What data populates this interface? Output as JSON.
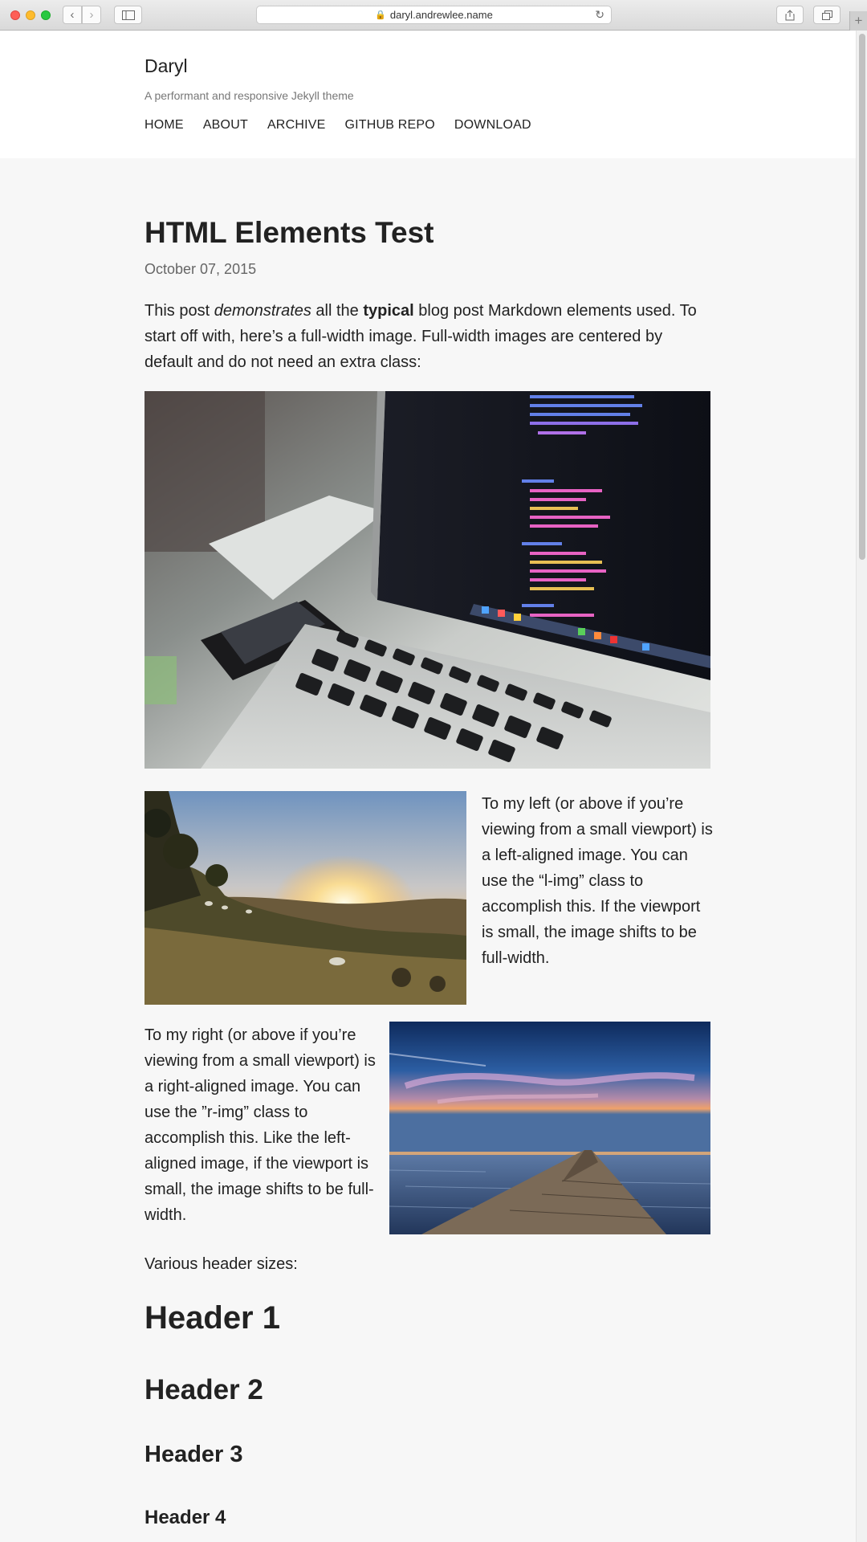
{
  "browser": {
    "url": "daryl.andrewlee.name",
    "back_icon": "chevron-left-icon",
    "forward_icon": "chevron-right-icon",
    "sidebar_icon": "sidebar-icon",
    "share_icon": "share-icon",
    "tabs_icon": "tabs-icon",
    "new_tab_label": "+"
  },
  "site": {
    "title": "Daryl",
    "tagline": "A performant and responsive Jekyll theme",
    "nav": [
      "HOME",
      "ABOUT",
      "ARCHIVE",
      "GITHUB REPO",
      "DOWNLOAD"
    ]
  },
  "post": {
    "title": "HTML Elements Test",
    "date": "October 07, 2015",
    "intro_prefix": "This post ",
    "intro_em": "demonstrates",
    "intro_mid": " all the ",
    "intro_strong": "typical",
    "intro_suffix": " blog post Markdown elements used. To start off with, here’s a full-width image. Full-width images are centered by default and do not need an extra class:",
    "left_text": "To my left (or above if you’re viewing from a small viewport) is a left-aligned image. You can use the “l-img” class to accomplish this. If the viewport is small, the image shifts to be full-width.",
    "right_text": "To my right (or above if you’re viewing from a small viewport) is a right-aligned image. You can use the ”r-img” class to accomplish this. Like the left-aligned image, if the viewport is small, the image shifts to be full-width.",
    "various": "Various header sizes:",
    "headers": [
      "Header 1",
      "Header 2",
      "Header 3",
      "Header 4"
    ]
  }
}
